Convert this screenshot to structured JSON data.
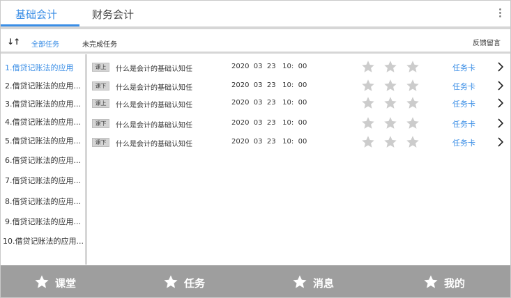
{
  "top_tabs": [
    {
      "label": "基础会计",
      "active": true
    },
    {
      "label": "财务会计",
      "active": false
    }
  ],
  "filter": {
    "all_tasks": "全部任务",
    "incomplete_tasks": "未完成任务",
    "feedback": "反馈留言"
  },
  "chapters": [
    {
      "label": "1.借贷记账法的应用",
      "active": true
    },
    {
      "label": "2.借贷记账法的应用...",
      "active": false
    },
    {
      "label": "3.借贷记账法的应用...",
      "active": false
    },
    {
      "label": "4.借贷记账法的应用...",
      "active": false
    },
    {
      "label": "5.借贷记账法的应用...",
      "active": false
    },
    {
      "label": "6.借贷记账法的应用...",
      "active": false
    },
    {
      "label": "7.借贷记账法的应用...",
      "active": false
    },
    {
      "label": "8.借贷记账法的应用...",
      "active": false
    },
    {
      "label": "9.借贷记账法的应用...",
      "active": false
    },
    {
      "label": "10.借贷记账法的应用...",
      "active": false
    }
  ],
  "tasks": [
    {
      "badge": "课上",
      "title": "什么是会计的基础认知任",
      "date": "2020  03  23   10:  00",
      "stars": 0,
      "card": "任务卡"
    },
    {
      "badge": "课下",
      "title": "什么是会计的基础认知任",
      "date": "2020  03  23   10:  00",
      "stars": 0,
      "card": "任务卡"
    },
    {
      "badge": "课上",
      "title": "什么是会计的基础认知任",
      "date": "2020  03  23   10:  00",
      "stars": 0,
      "card": "任务卡"
    },
    {
      "badge": "课下",
      "title": "什么是会计的基础认知任",
      "date": "2020  03  23   10:  00",
      "stars": 0,
      "card": "任务卡"
    },
    {
      "badge": "课下",
      "title": "什么是会计的基础认知任",
      "date": "2020  03  23   10:  00",
      "stars": 0,
      "card": "任务卡"
    }
  ],
  "bottom_nav": [
    {
      "label": "课堂",
      "icon": "star-icon"
    },
    {
      "label": "任务",
      "icon": "star-icon"
    },
    {
      "label": "消息",
      "icon": "star-icon"
    },
    {
      "label": "我的",
      "icon": "star-icon"
    }
  ],
  "colors": {
    "accent": "#3a8ee6",
    "star_inactive": "#cccccc",
    "nav_background": "#9e9e9e",
    "divider": "#d6d6d6"
  }
}
